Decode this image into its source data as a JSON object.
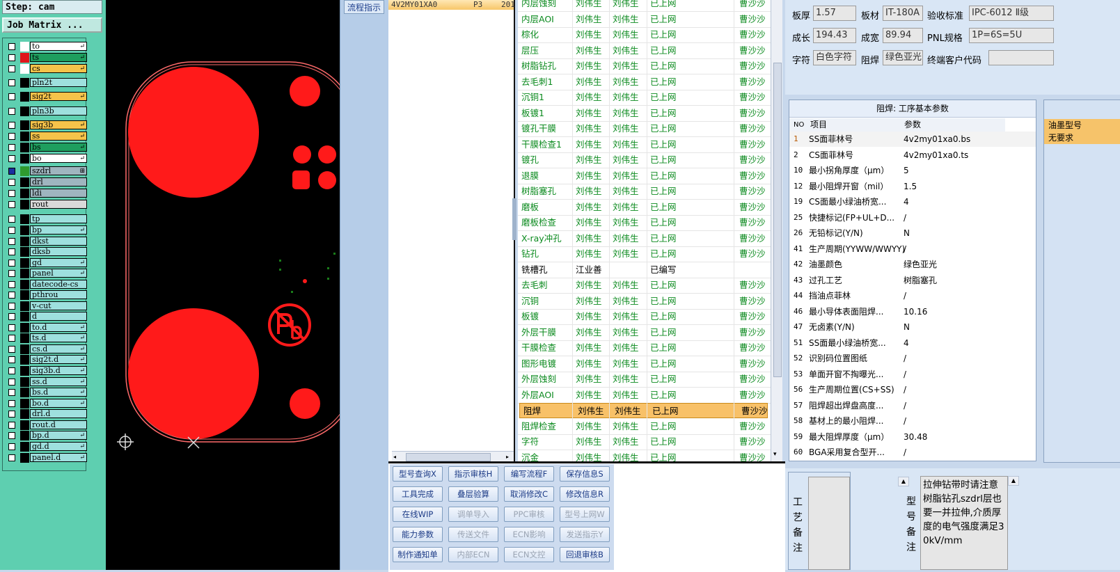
{
  "left_panel": {
    "step": "Step: cam",
    "job_matrix": "Job Matrix ...",
    "layers": [
      {
        "name": "to",
        "bg": "#ffffff",
        "color": "#ffffff",
        "mark": "↵"
      },
      {
        "name": "ts",
        "bg": "#1e9e5e",
        "color": "#e0161b",
        "mark": "↵"
      },
      {
        "name": "cs",
        "bg": "#f5c34a",
        "color": "#ffffff",
        "mark": "↵"
      },
      {
        "name": "pln2t",
        "bg": "#9ee0de",
        "color": "",
        "mark": ""
      },
      {
        "name": "sig2t",
        "bg": "#f5c34a",
        "color": "",
        "mark": "↵"
      },
      {
        "name": "pln3b",
        "bg": "#9ee0de",
        "color": "",
        "mark": ""
      },
      {
        "name": "sig3b",
        "bg": "#f5c34a",
        "color": "",
        "mark": "↵"
      },
      {
        "name": "ss",
        "bg": "#f5c34a",
        "color": "",
        "mark": "↵"
      },
      {
        "name": "bs",
        "bg": "#1e9e5e",
        "color": "",
        "mark": "↵"
      },
      {
        "name": "bo",
        "bg": "#ffffff",
        "color": "",
        "mark": "↵"
      },
      {
        "name": "szdrl",
        "bg": "#9fb5bf",
        "color": "#2f9a2f",
        "mark": "⊞"
      },
      {
        "name": "drl",
        "bg": "#9fb5bf",
        "color": "",
        "mark": ""
      },
      {
        "name": "ldi",
        "bg": "#9fb5bf",
        "color": "",
        "mark": ""
      },
      {
        "name": "rout",
        "bg": "#d9d9d9",
        "color": "",
        "mark": ""
      },
      {
        "name": "tp",
        "bg": "#9ee0de",
        "color": "",
        "mark": ""
      },
      {
        "name": "bp",
        "bg": "#9ee0de",
        "color": "",
        "mark": "↵"
      },
      {
        "name": "dkst",
        "bg": "#9ee0de",
        "color": "",
        "mark": ""
      },
      {
        "name": "dksb",
        "bg": "#9ee0de",
        "color": "",
        "mark": ""
      },
      {
        "name": "gd",
        "bg": "#9ee0de",
        "color": "",
        "mark": "↵"
      },
      {
        "name": "panel",
        "bg": "#9ee0de",
        "color": "",
        "mark": "↵"
      },
      {
        "name": "datecode-cs",
        "bg": "#9ee0de",
        "color": "",
        "mark": ""
      },
      {
        "name": "pthrou",
        "bg": "#9ee0de",
        "color": "",
        "mark": ""
      },
      {
        "name": "v-cut",
        "bg": "#9ee0de",
        "color": "",
        "mark": ""
      },
      {
        "name": "d",
        "bg": "#9ee0de",
        "color": "",
        "mark": ""
      },
      {
        "name": "to.d",
        "bg": "#9ee0de",
        "color": "",
        "mark": "↵"
      },
      {
        "name": "ts.d",
        "bg": "#9ee0de",
        "color": "",
        "mark": "↵"
      },
      {
        "name": "cs.d",
        "bg": "#9ee0de",
        "color": "",
        "mark": "↵"
      },
      {
        "name": "sig2t.d",
        "bg": "#9ee0de",
        "color": "",
        "mark": "↵"
      },
      {
        "name": "sig3b.d",
        "bg": "#9ee0de",
        "color": "",
        "mark": "↵"
      },
      {
        "name": "ss.d",
        "bg": "#9ee0de",
        "color": "",
        "mark": "↵"
      },
      {
        "name": "bs.d",
        "bg": "#9ee0de",
        "color": "",
        "mark": "↵"
      },
      {
        "name": "bo.d",
        "bg": "#9ee0de",
        "color": "",
        "mark": "↵"
      },
      {
        "name": "drl.d",
        "bg": "#9ee0de",
        "color": "",
        "mark": ""
      },
      {
        "name": "rout.d",
        "bg": "#9ee0de",
        "color": "",
        "mark": ""
      },
      {
        "name": "bp.d",
        "bg": "#9ee0de",
        "color": "",
        "mark": "↵"
      },
      {
        "name": "gd.d",
        "bg": "#9ee0de",
        "color": "",
        "mark": "↵"
      },
      {
        "name": "panel.d",
        "bg": "#9ee0de",
        "color": "",
        "mark": "↵"
      }
    ]
  },
  "flow_tab": "流程指示",
  "list": {
    "selected_row": {
      "model": "4V2MY01XA0",
      "rev": "P3",
      "date": "201"
    }
  },
  "process_rows": [
    {
      "step": "内层蚀刻",
      "maker": "刘伟生",
      "checker": "刘伟生",
      "status": "已上网",
      "owner": "曹沙沙",
      "kind": "online"
    },
    {
      "step": "内层AOI",
      "maker": "刘伟生",
      "checker": "刘伟生",
      "status": "已上网",
      "owner": "曹沙沙",
      "kind": "online"
    },
    {
      "step": "棕化",
      "maker": "刘伟生",
      "checker": "刘伟生",
      "status": "已上网",
      "owner": "曹沙沙",
      "kind": "online"
    },
    {
      "step": "层压",
      "maker": "刘伟生",
      "checker": "刘伟生",
      "status": "已上网",
      "owner": "曹沙沙",
      "kind": "online"
    },
    {
      "step": "树脂钻孔",
      "maker": "刘伟生",
      "checker": "刘伟生",
      "status": "已上网",
      "owner": "曹沙沙",
      "kind": "online"
    },
    {
      "step": "去毛刺1",
      "maker": "刘伟生",
      "checker": "刘伟生",
      "status": "已上网",
      "owner": "曹沙沙",
      "kind": "online"
    },
    {
      "step": "沉铜1",
      "maker": "刘伟生",
      "checker": "刘伟生",
      "status": "已上网",
      "owner": "曹沙沙",
      "kind": "online"
    },
    {
      "step": "板镀1",
      "maker": "刘伟生",
      "checker": "刘伟生",
      "status": "已上网",
      "owner": "曹沙沙",
      "kind": "online"
    },
    {
      "step": "镀孔干膜",
      "maker": "刘伟生",
      "checker": "刘伟生",
      "status": "已上网",
      "owner": "曹沙沙",
      "kind": "online"
    },
    {
      "step": "干膜检查1",
      "maker": "刘伟生",
      "checker": "刘伟生",
      "status": "已上网",
      "owner": "曹沙沙",
      "kind": "online"
    },
    {
      "step": "镀孔",
      "maker": "刘伟生",
      "checker": "刘伟生",
      "status": "已上网",
      "owner": "曹沙沙",
      "kind": "online"
    },
    {
      "step": "退膜",
      "maker": "刘伟生",
      "checker": "刘伟生",
      "status": "已上网",
      "owner": "曹沙沙",
      "kind": "online"
    },
    {
      "step": "树脂塞孔",
      "maker": "刘伟生",
      "checker": "刘伟生",
      "status": "已上网",
      "owner": "曹沙沙",
      "kind": "online"
    },
    {
      "step": "磨板",
      "maker": "刘伟生",
      "checker": "刘伟生",
      "status": "已上网",
      "owner": "曹沙沙",
      "kind": "online"
    },
    {
      "step": "磨板检查",
      "maker": "刘伟生",
      "checker": "刘伟生",
      "status": "已上网",
      "owner": "曹沙沙",
      "kind": "online"
    },
    {
      "step": "X-ray冲孔",
      "maker": "刘伟生",
      "checker": "刘伟生",
      "status": "已上网",
      "owner": "曹沙沙",
      "kind": "online"
    },
    {
      "step": "钻孔",
      "maker": "刘伟生",
      "checker": "刘伟生",
      "status": "已上网",
      "owner": "曹沙沙",
      "kind": "online"
    },
    {
      "step": "铣槽孔",
      "maker": "江业善",
      "checker": "",
      "status": "已编写",
      "owner": "",
      "kind": "written"
    },
    {
      "step": "去毛刺",
      "maker": "刘伟生",
      "checker": "刘伟生",
      "status": "已上网",
      "owner": "曹沙沙",
      "kind": "online"
    },
    {
      "step": "沉铜",
      "maker": "刘伟生",
      "checker": "刘伟生",
      "status": "已上网",
      "owner": "曹沙沙",
      "kind": "online"
    },
    {
      "step": "板镀",
      "maker": "刘伟生",
      "checker": "刘伟生",
      "status": "已上网",
      "owner": "曹沙沙",
      "kind": "online"
    },
    {
      "step": "外层干膜",
      "maker": "刘伟生",
      "checker": "刘伟生",
      "status": "已上网",
      "owner": "曹沙沙",
      "kind": "online"
    },
    {
      "step": "干膜检查",
      "maker": "刘伟生",
      "checker": "刘伟生",
      "status": "已上网",
      "owner": "曹沙沙",
      "kind": "online"
    },
    {
      "step": "图形电镀",
      "maker": "刘伟生",
      "checker": "刘伟生",
      "status": "已上网",
      "owner": "曹沙沙",
      "kind": "online"
    },
    {
      "step": "外层蚀刻",
      "maker": "刘伟生",
      "checker": "刘伟生",
      "status": "已上网",
      "owner": "曹沙沙",
      "kind": "online"
    },
    {
      "step": "外层AOI",
      "maker": "刘伟生",
      "checker": "刘伟生",
      "status": "已上网",
      "owner": "曹沙沙",
      "kind": "online"
    },
    {
      "step": "阻焊",
      "maker": "刘伟生",
      "checker": "刘伟生",
      "status": "已上网",
      "owner": "曹沙沙",
      "kind": "selected"
    },
    {
      "step": "阻焊检查",
      "maker": "刘伟生",
      "checker": "刘伟生",
      "status": "已上网",
      "owner": "曹沙沙",
      "kind": "online"
    },
    {
      "step": "字符",
      "maker": "刘伟生",
      "checker": "刘伟生",
      "status": "已上网",
      "owner": "曹沙沙",
      "kind": "online"
    },
    {
      "step": "沉金",
      "maker": "刘伟生",
      "checker": "刘伟生",
      "status": "已上网",
      "owner": "曹沙沙",
      "kind": "online"
    }
  ],
  "info": {
    "thickness_label": "板厚",
    "thickness": "1.57",
    "material_label": "板材",
    "material": "IT-180A",
    "standard_label": "验收标准",
    "standard": "IPC-6012 Ⅱ级",
    "growth_label": "成长",
    "growth": "194.43",
    "width_label": "成宽",
    "width": "89.94",
    "pnl_label": "PNL规格",
    "pnl": "1P=6S=5U",
    "char_label": "字符",
    "char": "白色字符",
    "mask_label": "阻焊",
    "mask": "绿色亚光",
    "customer_label": "终端客户代码",
    "customer": ""
  },
  "param_table": {
    "title": "阻焊: 工序基本参数",
    "headers": {
      "no": "NO",
      "item": "项目",
      "value": "参数"
    },
    "rows": [
      {
        "no": "1",
        "item": "SS面菲林号",
        "value": "4v2my01xa0.bs"
      },
      {
        "no": "2",
        "item": "CS面菲林号",
        "value": "4v2my01xa0.ts"
      },
      {
        "no": "10",
        "item": "最小拐角厚度（μm）",
        "value": "5"
      },
      {
        "no": "12",
        "item": "最小阻焊开窗（mil）",
        "value": "1.5"
      },
      {
        "no": "19",
        "item": "CS面最小绿油桥宽...",
        "value": "4"
      },
      {
        "no": "25",
        "item": "快捷标记(FP+UL+D...",
        "value": "/"
      },
      {
        "no": "26",
        "item": "无铅标记(Y/N)",
        "value": "N"
      },
      {
        "no": "41",
        "item": "生产周期(YYWW/WWYY)",
        "value": "/"
      },
      {
        "no": "42",
        "item": "油墨颜色",
        "value": "绿色亚光"
      },
      {
        "no": "43",
        "item": "过孔工艺",
        "value": "树脂塞孔"
      },
      {
        "no": "44",
        "item": "挡油点菲林",
        "value": "/"
      },
      {
        "no": "46",
        "item": "最小导体表面阻焊...",
        "value": "10.16"
      },
      {
        "no": "47",
        "item": "无卤素(Y/N)",
        "value": "N"
      },
      {
        "no": "51",
        "item": "SS面最小绿油桥宽...",
        "value": "4"
      },
      {
        "no": "52",
        "item": "识别码位置图纸",
        "value": "/"
      },
      {
        "no": "53",
        "item": "单面开窗不掏曝光...",
        "value": "/"
      },
      {
        "no": "56",
        "item": "生产周期位置(CS+SS)",
        "value": "/"
      },
      {
        "no": "57",
        "item": "阻焊超出焊盘高度...",
        "value": "/"
      },
      {
        "no": "58",
        "item": "基材上的最小阻焊...",
        "value": "/"
      },
      {
        "no": "59",
        "item": "最大阻焊厚度（μm）",
        "value": "30.48"
      },
      {
        "no": "60",
        "item": "BGA采用复合型开...",
        "value": "/"
      }
    ]
  },
  "oil": {
    "label": "油墨型号",
    "value": "无要求"
  },
  "buttons": [
    {
      "label": "型号查询X",
      "enabled": true
    },
    {
      "label": "指示审核H",
      "enabled": true
    },
    {
      "label": "编写流程F",
      "enabled": true
    },
    {
      "label": "保存信息S",
      "enabled": true
    },
    {
      "label": "工具完成",
      "enabled": true
    },
    {
      "label": "叠层验算",
      "enabled": true
    },
    {
      "label": "取消修改C",
      "enabled": true
    },
    {
      "label": "修改信息R",
      "enabled": true
    },
    {
      "label": "在线WIP",
      "enabled": true
    },
    {
      "label": "调单导入",
      "enabled": false
    },
    {
      "label": "PPC审核",
      "enabled": false
    },
    {
      "label": "型号上网W",
      "enabled": false
    },
    {
      "label": "能力参数",
      "enabled": true
    },
    {
      "label": "传送文件",
      "enabled": false
    },
    {
      "label": "ECN影响",
      "enabled": false
    },
    {
      "label": "发送指示Y",
      "enabled": false
    },
    {
      "label": "制作通知单",
      "enabled": true
    },
    {
      "label": "内部ECN",
      "enabled": false
    },
    {
      "label": "ECN文控",
      "enabled": false
    },
    {
      "label": "回退审核B",
      "enabled": true
    }
  ],
  "notes": {
    "process_label": "工艺备注",
    "model_label": "型号备注",
    "process_text": "",
    "model_text": "拉伸钻带时请注意树脂钻孔szdrl层也要一并拉伸,介质厚度的电气强度满足30kV/mm"
  },
  "colors": {
    "pad": "#ff1a1a",
    "outline": "#ff6b6b",
    "online_text": "#0b8a1e"
  }
}
